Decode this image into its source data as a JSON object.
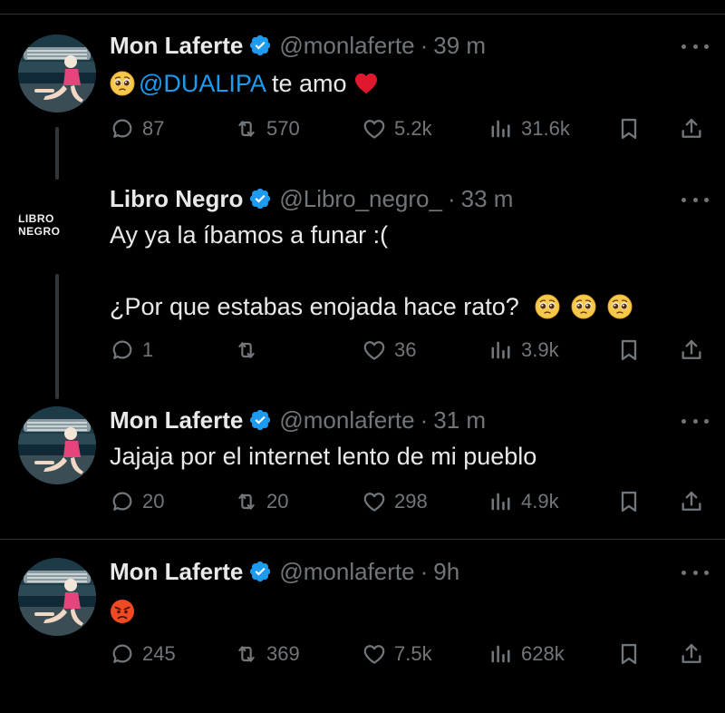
{
  "tweets": [
    {
      "name": "Mon Laferte",
      "handle": "@monlaferte",
      "time": "39 m",
      "mention": "@DUALIPA",
      "text_after_mention": "te amo",
      "stats": {
        "replies": "87",
        "retweets": "570",
        "likes": "5.2k",
        "views": "31.6k"
      }
    },
    {
      "name": "Libro Negro",
      "handle": "@Libro_negro_",
      "time": "33 m",
      "avatar_logo": "LIBRO NEGRO",
      "line1": "Ay ya la íbamos a funar :(",
      "line2": "¿Por que estabas enojada hace rato?",
      "stats": {
        "replies": "1",
        "retweets": "",
        "likes": "36",
        "views": "3.9k"
      }
    },
    {
      "name": "Mon Laferte",
      "handle": "@monlaferte",
      "time": "31 m",
      "text": "Jajaja por el internet lento de mi pueblo",
      "stats": {
        "replies": "20",
        "retweets": "20",
        "likes": "298",
        "views": "4.9k"
      }
    },
    {
      "name": "Mon Laferte",
      "handle": "@monlaferte",
      "time": "9h",
      "stats": {
        "replies": "245",
        "retweets": "369",
        "likes": "7.5k",
        "views": "628k"
      }
    }
  ],
  "separator": "·",
  "icons": [
    "verified-badge-icon",
    "more-icon",
    "reply-icon",
    "retweet-icon",
    "like-icon",
    "views-icon",
    "bookmark-icon",
    "share-icon",
    "pleading-face-icon",
    "heart-emoji-icon",
    "angry-face-icon"
  ],
  "colors": {
    "background": "#000000",
    "text": "#e7e9ea",
    "muted": "#71767b",
    "accent": "#1d9bf0",
    "divider": "#2f3336"
  }
}
